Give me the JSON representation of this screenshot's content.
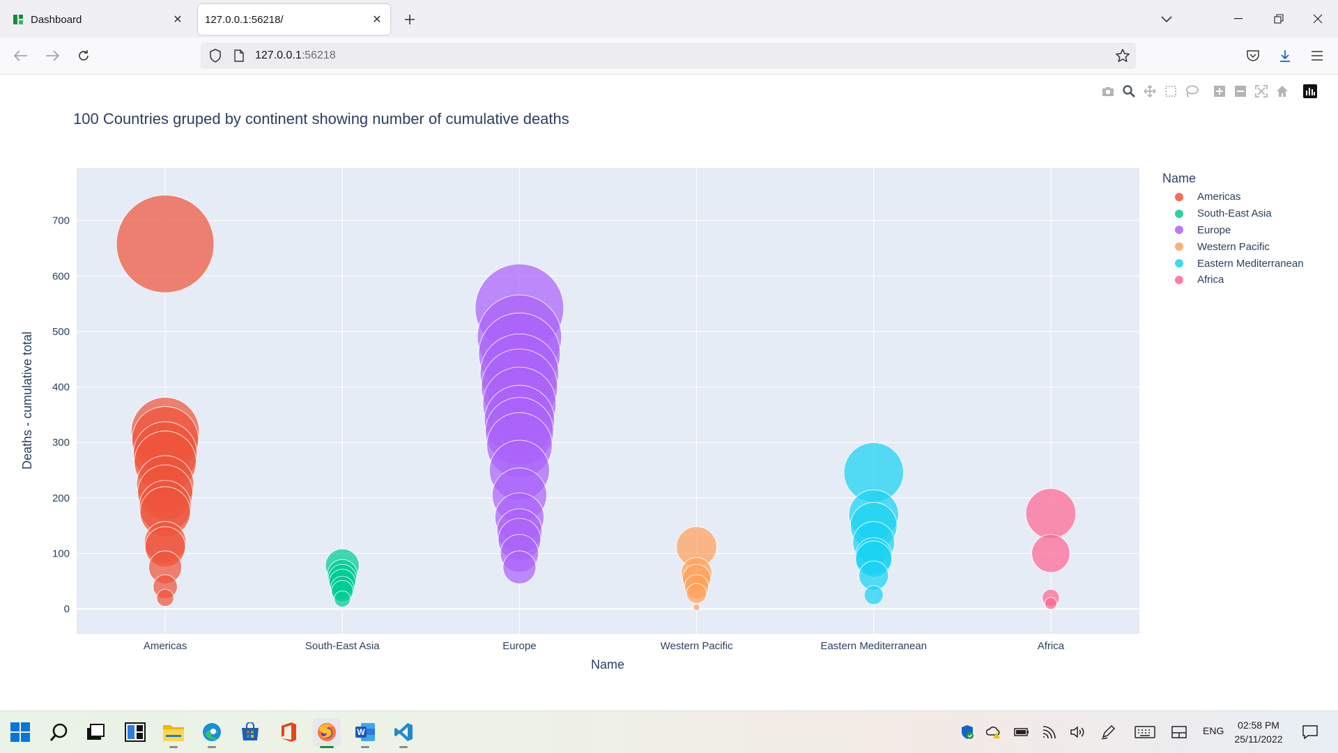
{
  "browser": {
    "tabs": [
      {
        "title": "Dashboard",
        "active": false
      },
      {
        "title": "127.0.0.1:56218/",
        "active": true
      }
    ],
    "url_host": "127.0.0.1",
    "url_port": ":56218"
  },
  "chart_data": {
    "type": "scatter",
    "subtype": "bubble",
    "title": "100 Countries gruped by continent showing number of cumulative deaths",
    "xlabel": "Name",
    "ylabel": "Deaths - cumulative total",
    "categories": [
      "Americas",
      "South-East Asia",
      "Europe",
      "Western Pacific",
      "Eastern Mediterranean",
      "Africa"
    ],
    "yticks": [
      0,
      100,
      200,
      300,
      400,
      500,
      600,
      700
    ],
    "ylim": [
      -45,
      795
    ],
    "grid": true,
    "legend_title": "Name",
    "legend_position": "right",
    "size_encodes": "y",
    "series": [
      {
        "name": "Americas",
        "color": "#EF553B",
        "x": "Americas",
        "y": [
          658,
          320,
          305,
          280,
          265,
          225,
          210,
          185,
          175,
          120,
          112,
          75,
          40,
          20
        ]
      },
      {
        "name": "South-East Asia",
        "color": "#00CC96",
        "x": "South-East Asia",
        "y": [
          78,
          62,
          55,
          48,
          38,
          32,
          18
        ]
      },
      {
        "name": "Europe",
        "color": "#AB63FA",
        "x": "Europe",
        "y": [
          542,
          490,
          460,
          425,
          400,
          370,
          340,
          320,
          295,
          250,
          205,
          165,
          140,
          125,
          100,
          75
        ]
      },
      {
        "name": "Western Pacific",
        "color": "#FFA15A",
        "x": "Western Pacific",
        "y": [
          112,
          65,
          55,
          40,
          28,
          3
        ]
      },
      {
        "name": "Eastern Mediterranean",
        "color": "#19D3F3",
        "x": "Eastern Mediterranean",
        "y": [
          246,
          170,
          150,
          120,
          95,
          90,
          60,
          25
        ]
      },
      {
        "name": "Africa",
        "color": "#FF6692",
        "x": "Africa",
        "y": [
          172,
          100,
          20,
          10
        ]
      }
    ]
  },
  "taskbar": {
    "apps": [
      "start-icon",
      "search-icon",
      "task-view-icon",
      "widgets-icon",
      "file-explorer-icon",
      "edge-icon",
      "store-icon",
      "office-icon",
      "firefox-icon",
      "word-icon",
      "vscode-icon"
    ],
    "tray": {
      "language": "ENG",
      "time": "02:58 PM",
      "date": "25/11/2022"
    }
  }
}
